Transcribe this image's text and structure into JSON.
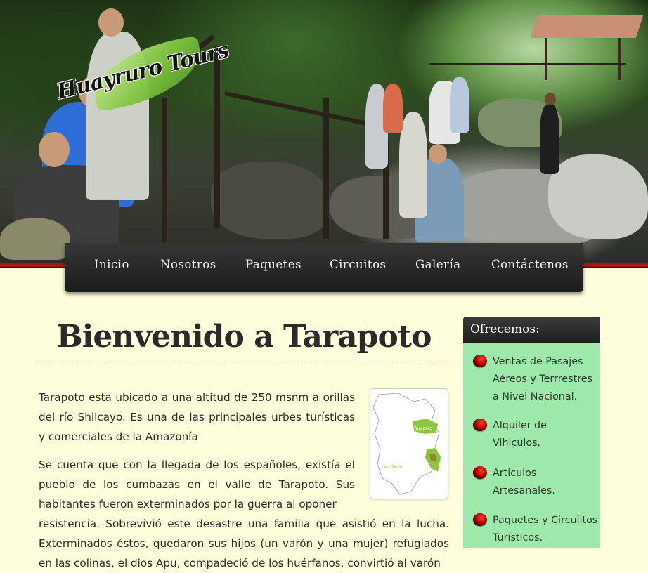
{
  "logo": {
    "text": "Huayruro Tours"
  },
  "nav": {
    "items": [
      "Inicio",
      "Nosotros",
      "Paquetes",
      "Circuitos",
      "Galería",
      "Contáctenos"
    ]
  },
  "main": {
    "title": "Bienvenido a Tarapoto",
    "map_label_city": "Tarapoto",
    "map_label_region": "San Martín",
    "paragraph1": "Tarapoto esta ubicado a una altitud de 250 msnm a orillas del río Shilcayo. Es una de las principales urbes turísticas y comerciales de la Amazonía",
    "paragraph2a": "Se cuenta que con la llegada de los españoles, existía el pueblo de los cumbazas en el valle de Tarapoto. Sus habitantes fueron exterminados por la guerra al oponer",
    "paragraph2b": "resistencia. Sobrevivió este desastre una familia que asistió en la lucha. Exterminados éstos, quedaron sus hijos (un varón y una mujer) refugiados en las colinas, el dios Apu, compadeció de los huérfanos, convirtió al varón"
  },
  "sidebar": {
    "title": "Ofrecemos:",
    "items": [
      "Ventas de Pasajes Aéreos y Terrrestres a Nivel Nacional.",
      "Alquiler de Vihiculos.",
      "Articulos Artesanales.",
      "Paquetes y Circulitos Turísticos."
    ]
  },
  "colors": {
    "background": "#fefedd",
    "nav": "#262626",
    "stripe": "#a51616",
    "sidebar": "#9ee8ac"
  }
}
